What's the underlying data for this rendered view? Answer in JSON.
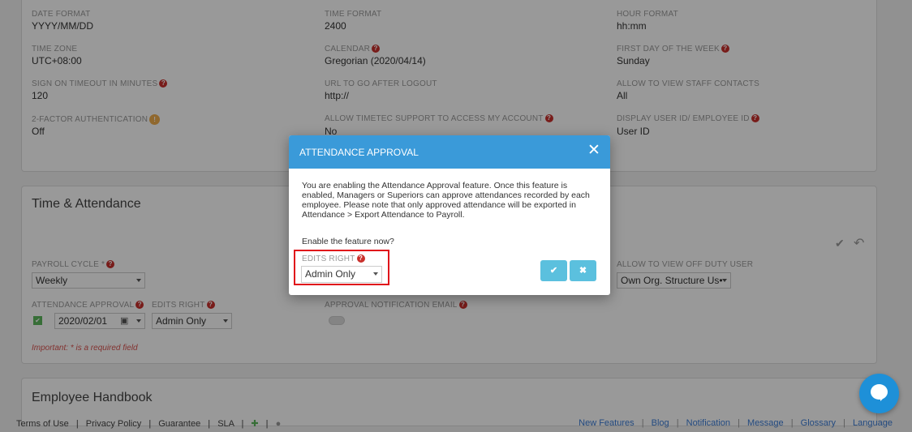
{
  "settings": {
    "date_format": {
      "label": "DATE FORMAT",
      "value": "YYYY/MM/DD"
    },
    "time_format": {
      "label": "TIME FORMAT",
      "value": "2400"
    },
    "hour_format": {
      "label": "HOUR FORMAT",
      "value": "hh:mm"
    },
    "time_zone": {
      "label": "TIME ZONE",
      "value": "UTC+08:00"
    },
    "calendar": {
      "label": "CALENDAR",
      "value": "Gregorian (2020/04/14)"
    },
    "first_day": {
      "label": "FIRST DAY OF THE WEEK",
      "value": "Sunday"
    },
    "sign_on_timeout": {
      "label": "SIGN ON TIMEOUT IN MINUTES",
      "value": "120"
    },
    "url_logout": {
      "label": "URL TO GO AFTER LOGOUT",
      "value": "http://"
    },
    "staff_contacts": {
      "label": "ALLOW TO VIEW STAFF CONTACTS",
      "value": "All"
    },
    "two_factor": {
      "label": "2-FACTOR AUTHENTICATION",
      "value": "Off"
    },
    "timetec_support": {
      "label": "ALLOW TIMETEC SUPPORT TO ACCESS MY ACCOUNT",
      "value": "No"
    },
    "display_user_id": {
      "label": "DISPLAY USER ID/ EMPLOYEE ID",
      "value": "User ID"
    }
  },
  "time_attendance": {
    "title": "Time & Attendance",
    "payroll_cycle": {
      "label": "PAYROLL CYCLE *",
      "value": "Weekly"
    },
    "off_duty_user": {
      "label": "ALLOW TO VIEW OFF DUTY USER",
      "value": "Own Org. Structure Us•"
    },
    "attendance_approval": {
      "label": "ATTENDANCE APPROVAL",
      "date": "2020/02/01"
    },
    "edits_right": {
      "label": "EDITS RIGHT",
      "value": "Admin Only"
    },
    "approval_email": {
      "label": "APPROVAL NOTIFICATION EMAIL"
    },
    "important_note": "Important: * is a required field"
  },
  "employee_handbook": {
    "title": "Employee Handbook"
  },
  "modal": {
    "title": "ATTENDANCE APPROVAL",
    "body": "You are enabling the Attendance Approval feature. Once this feature is enabled, Managers or Superiors can approve attendances recorded by each employee. Please note that only approved attendance will be exported in Attendance > Export Attendance to Payroll.",
    "question": "Enable the feature now?",
    "edits_right_label": "EDITS RIGHT",
    "edits_right_value": "Admin Only",
    "confirm_icon": "check-icon",
    "cancel_icon": "close-icon"
  },
  "footer": {
    "left": [
      "Terms of Use",
      "Privacy Policy",
      "Guarantee",
      "SLA"
    ],
    "right": [
      "New Features",
      "Blog",
      "Notification",
      "Message",
      "Glossary",
      "Language"
    ]
  },
  "colors": {
    "header_blue": "#3a9ad9",
    "button_cyan": "#5bc0de",
    "help_red": "#c9302c",
    "highlight_red": "#e0101a"
  }
}
